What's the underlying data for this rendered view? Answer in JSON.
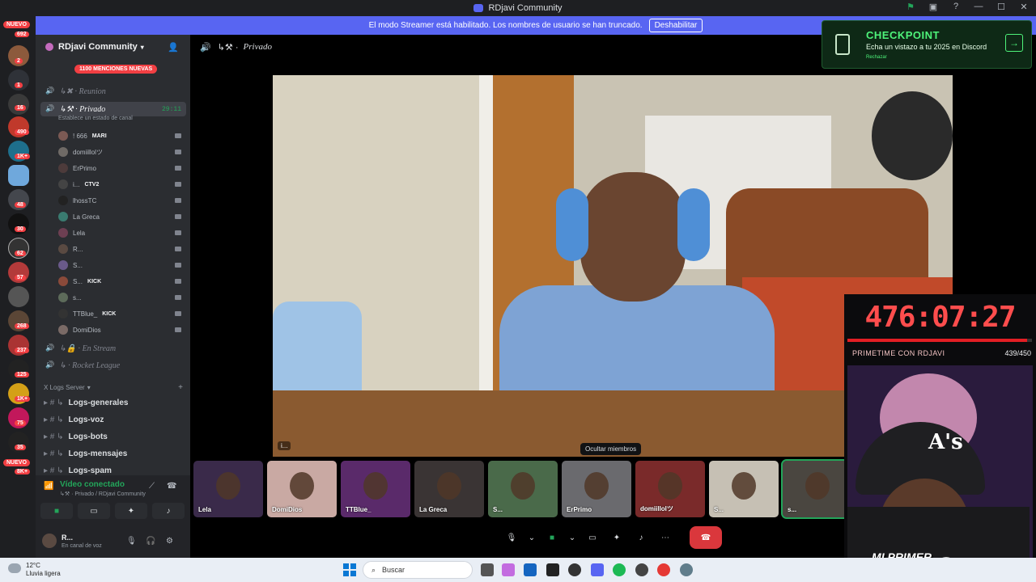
{
  "window": {
    "title": "RDjavi Community"
  },
  "banner": {
    "text": "El modo Streamer está habilitado. Los nombres de usuario se han truncado.",
    "button": "Deshabilitar"
  },
  "rail": {
    "nuevo_top": "NUEVO",
    "nuevo_bottom": "NUEVO",
    "badges": [
      "692",
      "2",
      "1",
      "16",
      "490",
      "1K+",
      "48",
      "30",
      "62",
      "57",
      "268",
      "237",
      "125",
      "1K+",
      "75",
      "35",
      "8K+"
    ]
  },
  "sidebar": {
    "server_name": "RDjavi Community",
    "mentions_pill": "1100 MENCIONES NUEVAS",
    "channels_top": [
      {
        "prefix": "↳✖ ·",
        "name": "Reunion"
      }
    ],
    "active_channel": {
      "prefix": "↳⚒ ·",
      "name": "Privado",
      "timer": "29:11",
      "status": "Establece un estado de canal"
    },
    "members": [
      {
        "name": "! 666",
        "extra": "MARI",
        "color": "#7b5a54"
      },
      {
        "name": "domiillolツ",
        "extra": "",
        "color": "#6f6a66"
      },
      {
        "name": "ErPrimo",
        "extra": "",
        "color": "#4d3b3b"
      },
      {
        "name": "i...",
        "extra": "CTV2",
        "color": "#444"
      },
      {
        "name": "lhossTC",
        "extra": "",
        "color": "#222"
      },
      {
        "name": "La Greca",
        "extra": "",
        "color": "#3a7b70"
      },
      {
        "name": "Lela",
        "extra": "",
        "color": "#6d3f52"
      },
      {
        "name": "R...",
        "extra": "",
        "color": "#5a4a42"
      },
      {
        "name": "S...",
        "extra": "",
        "color": "#6a5a8a"
      },
      {
        "name": "S...",
        "extra": "KICK",
        "color": "#8a4a3a"
      },
      {
        "name": "s...",
        "extra": "",
        "color": "#5d6b5a"
      },
      {
        "name": "TTBlue_",
        "extra": "KICK",
        "color": "#333"
      },
      {
        "name": "DomiDios",
        "extra": "",
        "color": "#7a6a66"
      }
    ],
    "channels_bottom": [
      {
        "prefix": "↳🔒 ·",
        "name": "En Stream"
      },
      {
        "prefix": "↳  ·",
        "name": "Rocket League"
      }
    ],
    "category": "X Logs Server",
    "text_channels": [
      "Logs-generales",
      "Logs-voz",
      "Logs-bots",
      "Logs-mensajes",
      "Logs-spam"
    ]
  },
  "voice": {
    "connected": "Vídeo conectado",
    "sub": "↳⚒ · Privado / RDjavi Community"
  },
  "user": {
    "name": "R...",
    "status": "En canal de voz"
  },
  "call": {
    "header_prefix": "↳⚒ ·",
    "header_name": "Privado",
    "video_label": "i...",
    "hide_members": "Ocultar miembros",
    "thumbs": [
      {
        "label": "Lela",
        "bg": "#3a2a4a"
      },
      {
        "label": "DomiDios",
        "bg": "#c9a9a3"
      },
      {
        "label": "TTBlue_",
        "bg": "#5a2a6a"
      },
      {
        "label": "La Greca",
        "bg": "#3a3434"
      },
      {
        "label": "S...",
        "bg": "#4a6a4a"
      },
      {
        "label": "ErPrimo",
        "bg": "#6a6a6e"
      },
      {
        "label": "domiillolツ",
        "bg": "#7a2a2a"
      },
      {
        "label": "S...",
        "bg": "#c6c0b4"
      },
      {
        "label": "s...",
        "bg": "#4a4640"
      }
    ]
  },
  "checkpoint": {
    "title": "CHECKPOINT",
    "subtitle": "Echa un vistazo a tu 2025 en Discord",
    "dismiss": "Rechazar"
  },
  "overlay": {
    "timer": "476:07:27",
    "title": "PRIMETIME CON RDJAVI",
    "count": "439/450",
    "progress": 0.9756,
    "caption": "MI PRIMER CARRO",
    "colors": {
      "timer": "#ff4d4d",
      "bar": "#e31e24"
    }
  },
  "taskbar": {
    "temp": "12°C",
    "weather": "Lluvia ligera",
    "search": "Buscar"
  },
  "colors": {
    "accent": "#5865f2",
    "connected": "#23a55a",
    "danger": "#da373c",
    "checkpoint": "#4ef37a"
  }
}
